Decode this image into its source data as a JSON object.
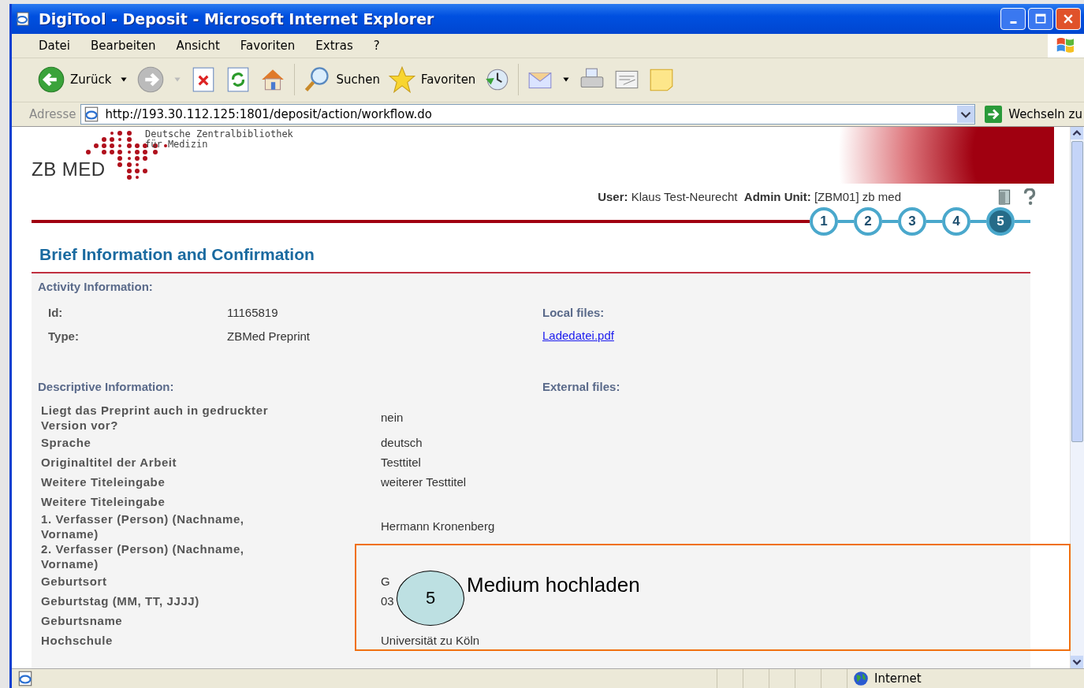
{
  "window": {
    "title": "DigiTool - Deposit - Microsoft Internet Explorer"
  },
  "menu": [
    "Datei",
    "Bearbeiten",
    "Ansicht",
    "Favoriten",
    "Extras",
    "?"
  ],
  "toolbar": {
    "back": "Zurück",
    "search": "Suchen",
    "favorites": "Favoriten"
  },
  "address": {
    "label": "Adresse",
    "url": "http://193.30.112.125:1801/deposit/action/workflow.do",
    "go": "Wechseln zu"
  },
  "header": {
    "logo_caption_1": "Deutsche Zentralbibliothek",
    "logo_caption_2": "für Medizin",
    "logo": "ZB MED",
    "user_label": "User:",
    "user": "Klaus Test-Neurecht",
    "unit_label": "Admin Unit:",
    "unit": "[ZBM01] zb med"
  },
  "steps": [
    {
      "label": "1",
      "selected": false
    },
    {
      "label": "2",
      "selected": false
    },
    {
      "label": "3",
      "selected": false
    },
    {
      "label": "4",
      "selected": false
    },
    {
      "label": "5",
      "selected": true
    }
  ],
  "page_title": "Brief Information and Confirmation",
  "activity": {
    "heading": "Activity Information:",
    "rows": [
      {
        "label": "Id:",
        "value": "11165819"
      },
      {
        "label": "Type:",
        "value": "ZBMed Preprint"
      }
    ],
    "local_heading": "Local files:",
    "local_files": [
      "Ladedatei.pdf"
    ]
  },
  "descriptive": {
    "heading": "Descriptive Information:",
    "external_heading": "External files:",
    "rows": [
      {
        "label": "Liegt das Preprint auch in gedruckter Version vor?",
        "value": "nein"
      },
      {
        "label": "Sprache",
        "value": "deutsch"
      },
      {
        "label": "Originaltitel der Arbeit",
        "value": "Testtitel"
      },
      {
        "label": "Weitere Titeleingabe",
        "value": "weiterer Testtitel"
      },
      {
        "label": "Weitere Titeleingabe"
      },
      {
        "label": "1. Verfasser (Person) (Nachname, Vorname)",
        "value": "Hermann Kronenberg"
      },
      {
        "label": "2. Verfasser (Person) (Nachname, Vorname)"
      },
      {
        "label": "Geburtsort",
        "value": "G"
      },
      {
        "label": "Geburtstag (MM, TT, JJJJ)",
        "value": "03"
      },
      {
        "label": "Geburtsname"
      },
      {
        "label": "Hochschule",
        "value": "Universität zu Köln"
      }
    ]
  },
  "annotation": {
    "number": "5",
    "text": "Medium hochladen"
  },
  "status_bar": {
    "zone": "Internet"
  }
}
